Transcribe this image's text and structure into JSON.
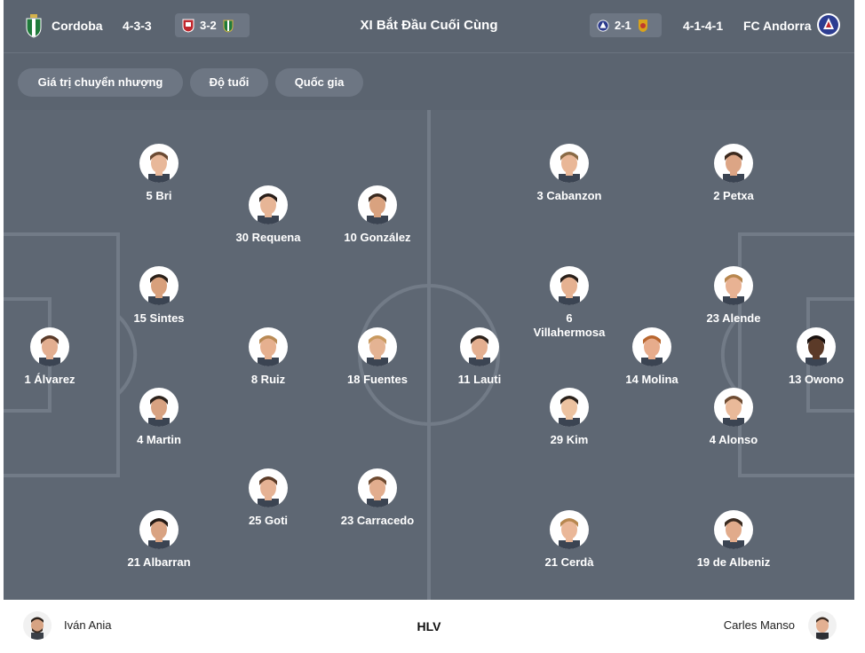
{
  "header": {
    "home_team": "Cordoba",
    "home_formation": "4-3-3",
    "home_score_pill": "3-2",
    "title": "XI Bắt Đầu Cuối Cùng",
    "away_score_pill": "2-1",
    "away_formation": "4-1-4-1",
    "away_team": "FC Andorra"
  },
  "filters": [
    "Giá trị chuyển nhượng",
    "Độ tuổi",
    "Quốc gia"
  ],
  "home_players": [
    {
      "label": "5 Bri",
      "skin": "#e8b89a",
      "hair": "#6b4a33"
    },
    {
      "label": "30 Requena",
      "skin": "#e7b596",
      "hair": "#2a1f1a"
    },
    {
      "label": "10 González",
      "skin": "#d9a27f",
      "hair": "#3a2a20"
    },
    {
      "label": "15 Sintes",
      "skin": "#d8a07c",
      "hair": "#2b2019"
    },
    {
      "label": "1 Álvarez",
      "skin": "#e3ae90",
      "hair": "#5a3b2a"
    },
    {
      "label": "8 Ruiz",
      "skin": "#e6b08f",
      "hair": "#b98a55"
    },
    {
      "label": "18 Fuentes",
      "skin": "#e4b393",
      "hair": "#c99a60"
    },
    {
      "label": "4 Martin",
      "skin": "#d8a281",
      "hair": "#2c221c"
    },
    {
      "label": "25 Goti",
      "skin": "#e5b294",
      "hair": "#5b3b27"
    },
    {
      "label": "23 Carracedo",
      "skin": "#e2ad8e",
      "hair": "#6e4a30"
    },
    {
      "label": "21 Albarran",
      "skin": "#d9a382",
      "hair": "#241b16"
    }
  ],
  "away_players": [
    {
      "label": "3 Cabanzon",
      "skin": "#e9b797",
      "hair": "#8a6a45"
    },
    {
      "label": "2 Petxa",
      "skin": "#dca585",
      "hair": "#3c2a1e"
    },
    {
      "label": "6 Villahermosa",
      "skin": "#e5b191",
      "hair": "#2a201a"
    },
    {
      "label": "23 Alende",
      "skin": "#e8b293",
      "hair": "#b7864e"
    },
    {
      "label": "11 Lauti",
      "skin": "#e4af90",
      "hair": "#2d221b"
    },
    {
      "label": "14 Molina",
      "skin": "#e7ac8c",
      "hair": "#b8662f"
    },
    {
      "label": "13 Owono",
      "skin": "#5b3a28",
      "hair": "#1a1210"
    },
    {
      "label": "29 Kim",
      "skin": "#ecc2a0",
      "hair": "#2a211b"
    },
    {
      "label": "4 Alonso",
      "skin": "#e9b999",
      "hair": "#6d4b32"
    },
    {
      "label": "21 Cerdà",
      "skin": "#eab798",
      "hair": "#b7874f"
    },
    {
      "label": "19 de Albeniz",
      "skin": "#e1ab8b",
      "hair": "#3a2b21"
    }
  ],
  "coach": {
    "label": "HLV",
    "home_coach": "Iván Ania",
    "away_coach": "Carles Manso"
  },
  "colors": {
    "pitch": "#5e6773",
    "header": "#5b6470",
    "chip": "#6d7683",
    "pitch_line": "#727b87"
  }
}
